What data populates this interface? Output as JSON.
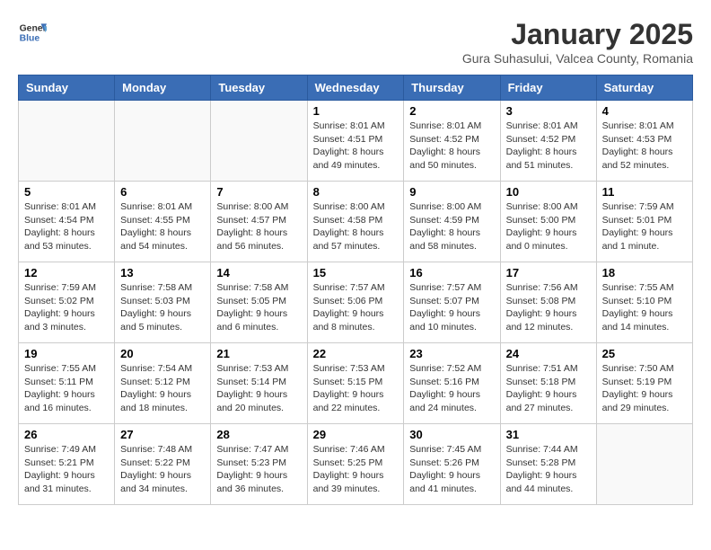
{
  "header": {
    "logo": {
      "general": "General",
      "blue": "Blue"
    },
    "title": "January 2025",
    "subtitle": "Gura Suhasului, Valcea County, Romania"
  },
  "days_of_week": [
    "Sunday",
    "Monday",
    "Tuesday",
    "Wednesday",
    "Thursday",
    "Friday",
    "Saturday"
  ],
  "weeks": [
    [
      {
        "day": "",
        "info": ""
      },
      {
        "day": "",
        "info": ""
      },
      {
        "day": "",
        "info": ""
      },
      {
        "day": "1",
        "info": "Sunrise: 8:01 AM\nSunset: 4:51 PM\nDaylight: 8 hours\nand 49 minutes."
      },
      {
        "day": "2",
        "info": "Sunrise: 8:01 AM\nSunset: 4:52 PM\nDaylight: 8 hours\nand 50 minutes."
      },
      {
        "day": "3",
        "info": "Sunrise: 8:01 AM\nSunset: 4:52 PM\nDaylight: 8 hours\nand 51 minutes."
      },
      {
        "day": "4",
        "info": "Sunrise: 8:01 AM\nSunset: 4:53 PM\nDaylight: 8 hours\nand 52 minutes."
      }
    ],
    [
      {
        "day": "5",
        "info": "Sunrise: 8:01 AM\nSunset: 4:54 PM\nDaylight: 8 hours\nand 53 minutes."
      },
      {
        "day": "6",
        "info": "Sunrise: 8:01 AM\nSunset: 4:55 PM\nDaylight: 8 hours\nand 54 minutes."
      },
      {
        "day": "7",
        "info": "Sunrise: 8:00 AM\nSunset: 4:57 PM\nDaylight: 8 hours\nand 56 minutes."
      },
      {
        "day": "8",
        "info": "Sunrise: 8:00 AM\nSunset: 4:58 PM\nDaylight: 8 hours\nand 57 minutes."
      },
      {
        "day": "9",
        "info": "Sunrise: 8:00 AM\nSunset: 4:59 PM\nDaylight: 8 hours\nand 58 minutes."
      },
      {
        "day": "10",
        "info": "Sunrise: 8:00 AM\nSunset: 5:00 PM\nDaylight: 9 hours\nand 0 minutes."
      },
      {
        "day": "11",
        "info": "Sunrise: 7:59 AM\nSunset: 5:01 PM\nDaylight: 9 hours\nand 1 minute."
      }
    ],
    [
      {
        "day": "12",
        "info": "Sunrise: 7:59 AM\nSunset: 5:02 PM\nDaylight: 9 hours\nand 3 minutes."
      },
      {
        "day": "13",
        "info": "Sunrise: 7:58 AM\nSunset: 5:03 PM\nDaylight: 9 hours\nand 5 minutes."
      },
      {
        "day": "14",
        "info": "Sunrise: 7:58 AM\nSunset: 5:05 PM\nDaylight: 9 hours\nand 6 minutes."
      },
      {
        "day": "15",
        "info": "Sunrise: 7:57 AM\nSunset: 5:06 PM\nDaylight: 9 hours\nand 8 minutes."
      },
      {
        "day": "16",
        "info": "Sunrise: 7:57 AM\nSunset: 5:07 PM\nDaylight: 9 hours\nand 10 minutes."
      },
      {
        "day": "17",
        "info": "Sunrise: 7:56 AM\nSunset: 5:08 PM\nDaylight: 9 hours\nand 12 minutes."
      },
      {
        "day": "18",
        "info": "Sunrise: 7:55 AM\nSunset: 5:10 PM\nDaylight: 9 hours\nand 14 minutes."
      }
    ],
    [
      {
        "day": "19",
        "info": "Sunrise: 7:55 AM\nSunset: 5:11 PM\nDaylight: 9 hours\nand 16 minutes."
      },
      {
        "day": "20",
        "info": "Sunrise: 7:54 AM\nSunset: 5:12 PM\nDaylight: 9 hours\nand 18 minutes."
      },
      {
        "day": "21",
        "info": "Sunrise: 7:53 AM\nSunset: 5:14 PM\nDaylight: 9 hours\nand 20 minutes."
      },
      {
        "day": "22",
        "info": "Sunrise: 7:53 AM\nSunset: 5:15 PM\nDaylight: 9 hours\nand 22 minutes."
      },
      {
        "day": "23",
        "info": "Sunrise: 7:52 AM\nSunset: 5:16 PM\nDaylight: 9 hours\nand 24 minutes."
      },
      {
        "day": "24",
        "info": "Sunrise: 7:51 AM\nSunset: 5:18 PM\nDaylight: 9 hours\nand 27 minutes."
      },
      {
        "day": "25",
        "info": "Sunrise: 7:50 AM\nSunset: 5:19 PM\nDaylight: 9 hours\nand 29 minutes."
      }
    ],
    [
      {
        "day": "26",
        "info": "Sunrise: 7:49 AM\nSunset: 5:21 PM\nDaylight: 9 hours\nand 31 minutes."
      },
      {
        "day": "27",
        "info": "Sunrise: 7:48 AM\nSunset: 5:22 PM\nDaylight: 9 hours\nand 34 minutes."
      },
      {
        "day": "28",
        "info": "Sunrise: 7:47 AM\nSunset: 5:23 PM\nDaylight: 9 hours\nand 36 minutes."
      },
      {
        "day": "29",
        "info": "Sunrise: 7:46 AM\nSunset: 5:25 PM\nDaylight: 9 hours\nand 39 minutes."
      },
      {
        "day": "30",
        "info": "Sunrise: 7:45 AM\nSunset: 5:26 PM\nDaylight: 9 hours\nand 41 minutes."
      },
      {
        "day": "31",
        "info": "Sunrise: 7:44 AM\nSunset: 5:28 PM\nDaylight: 9 hours\nand 44 minutes."
      },
      {
        "day": "",
        "info": ""
      }
    ]
  ]
}
